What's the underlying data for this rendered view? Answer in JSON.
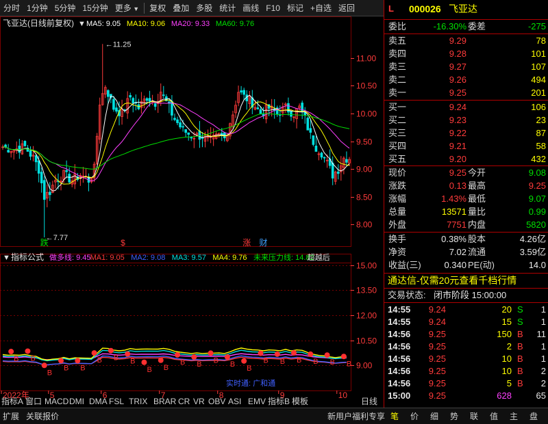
{
  "toolbar": {
    "items": [
      "分时",
      "1分钟",
      "5分钟",
      "15分钟",
      "更多",
      "复权",
      "叠加",
      "多股",
      "统计",
      "画线",
      "F10",
      "标记",
      "+自选",
      "返回"
    ]
  },
  "main_chart": {
    "stock_label": "飞亚达(日线前复权)",
    "ma_legend": [
      {
        "text": "MA5: 9.05",
        "color": "#ffffff"
      },
      {
        "text": "MA10: 9.06",
        "color": "#ffff00"
      },
      {
        "text": "MA20: 9.33",
        "color": "#ff40ff"
      },
      {
        "text": "MA60: 9.76",
        "color": "#00e000"
      }
    ],
    "high_label": "11.25",
    "low_label": "7.77",
    "event_labels": [
      {
        "text": "跌",
        "color": "#00e000"
      },
      {
        "text": "$",
        "color": "#ff3b3b"
      },
      {
        "text": "涨",
        "color": "#ff3b3b"
      },
      {
        "text": "财",
        "color": "#40a0ff"
      }
    ]
  },
  "indicator": {
    "title": "指标公式",
    "legend": [
      {
        "text": "做多线: 9.45",
        "color": "#ff40ff"
      },
      {
        "text": "MA1: 9.05",
        "color": "#ff3b3b"
      },
      {
        "text": "MA2: 9.08",
        "color": "#4060ff"
      },
      {
        "text": "MA3: 9.57",
        "color": "#00e0e0"
      },
      {
        "text": "MA4: 9.76",
        "color": "#ffff00"
      },
      {
        "text": "未来压力线: 14.82",
        "color": "#00e000"
      },
      {
        "text": "超越后",
        "color": "#e0e0e0"
      }
    ],
    "watermark": "实时通: 广和通"
  },
  "chart_data": [
    {
      "type": "candlestick",
      "title": "飞亚达(日线前复权)",
      "y_ticks": [
        8.0,
        8.5,
        9.0,
        9.5,
        10.0,
        10.5,
        11.0
      ],
      "ylim": [
        7.6,
        11.5
      ],
      "x_ticks": [
        {
          "label": "2022年",
          "index": 0
        },
        {
          "label": "5",
          "index": 17
        },
        {
          "label": "6",
          "index": 36
        },
        {
          "label": "7",
          "index": 57
        },
        {
          "label": "8",
          "index": 78
        },
        {
          "label": "9",
          "index": 100
        },
        {
          "label": "10",
          "index": 121
        }
      ],
      "annotations": [
        {
          "text": "11.25",
          "index": 36,
          "value": 11.25
        },
        {
          "text": "7.77",
          "index": 15,
          "value": 7.77
        }
      ],
      "series": [
        {
          "name": "MA5",
          "color": "#ffffff",
          "last": 9.05
        },
        {
          "name": "MA10",
          "color": "#ffff00",
          "last": 9.06
        },
        {
          "name": "MA20",
          "color": "#ff40ff",
          "last": 9.33
        },
        {
          "name": "MA60",
          "color": "#00e000",
          "last": 9.76
        }
      ],
      "close_path": [
        [
          0,
          9.4
        ],
        [
          4,
          9.35
        ],
        [
          8,
          9.4
        ],
        [
          11,
          9.2
        ],
        [
          13,
          9.0
        ],
        [
          15,
          8.5
        ],
        [
          17,
          8.6
        ],
        [
          19,
          8.8
        ],
        [
          22,
          8.9
        ],
        [
          25,
          8.8
        ],
        [
          28,
          8.9
        ],
        [
          31,
          8.8
        ],
        [
          33,
          9.0
        ],
        [
          35,
          10.2
        ],
        [
          37,
          10.5
        ],
        [
          40,
          10.1
        ],
        [
          43,
          10.0
        ],
        [
          46,
          10.3
        ],
        [
          49,
          10.1
        ],
        [
          52,
          10.3
        ],
        [
          55,
          10.2
        ],
        [
          57,
          10.4
        ],
        [
          59,
          10.2
        ],
        [
          62,
          9.9
        ],
        [
          65,
          9.7
        ],
        [
          68,
          9.6
        ],
        [
          72,
          9.6
        ],
        [
          75,
          9.5
        ],
        [
          78,
          9.6
        ],
        [
          80,
          9.55
        ],
        [
          83,
          10.0
        ],
        [
          85,
          10.4
        ],
        [
          87,
          10.3
        ],
        [
          90,
          10.2
        ],
        [
          93,
          10.0
        ],
        [
          96,
          10.1
        ],
        [
          99,
          10.0
        ],
        [
          102,
          10.1
        ],
        [
          105,
          10.0
        ],
        [
          107,
          10.1
        ],
        [
          109,
          9.9
        ],
        [
          111,
          9.6
        ],
        [
          113,
          9.4
        ],
        [
          115,
          9.3
        ],
        [
          117,
          9.1
        ],
        [
          119,
          8.9
        ],
        [
          121,
          9.0
        ],
        [
          123,
          9.2
        ]
      ]
    },
    {
      "type": "line",
      "title": "指标公式",
      "y_ticks": [
        9.0,
        10.5,
        12.0,
        13.5,
        15.0
      ],
      "ylim": [
        8.4,
        15.4
      ],
      "series": [
        {
          "name": "做多线",
          "color": "#ff40ff",
          "last": 9.45
        },
        {
          "name": "MA1",
          "color": "#ff3b3b",
          "last": 9.05
        },
        {
          "name": "MA2",
          "color": "#4060ff",
          "last": 9.08
        },
        {
          "name": "MA3",
          "color": "#00e0e0",
          "last": 9.57
        },
        {
          "name": "MA4",
          "color": "#ffff00",
          "last": 9.76
        },
        {
          "name": "未来压力线",
          "color": "#00e000",
          "last": 14.82
        }
      ]
    }
  ],
  "quote": {
    "level": "L",
    "code": "000026",
    "name": "飞亚达",
    "webi_label": "委比",
    "webi": "-16.30%",
    "weicha_label": "委差",
    "weicha": "-275",
    "asks": [
      {
        "label": "卖五",
        "price": "9.29",
        "vol": "78"
      },
      {
        "label": "卖四",
        "price": "9.28",
        "vol": "101"
      },
      {
        "label": "卖三",
        "price": "9.27",
        "vol": "107"
      },
      {
        "label": "卖二",
        "price": "9.26",
        "vol": "494"
      },
      {
        "label": "卖一",
        "price": "9.25",
        "vol": "201"
      }
    ],
    "bids": [
      {
        "label": "买一",
        "price": "9.24",
        "vol": "106"
      },
      {
        "label": "买二",
        "price": "9.23",
        "vol": "23"
      },
      {
        "label": "买三",
        "price": "9.22",
        "vol": "87"
      },
      {
        "label": "买四",
        "price": "9.21",
        "vol": "58"
      },
      {
        "label": "买五",
        "price": "9.20",
        "vol": "432"
      }
    ],
    "stats": [
      {
        "l1": "现价",
        "v1": "9.25",
        "c1": "red",
        "l2": "今开",
        "v2": "9.08",
        "c2": "green"
      },
      {
        "l1": "涨跌",
        "v1": "0.13",
        "c1": "red",
        "l2": "最高",
        "v2": "9.25",
        "c2": "red"
      },
      {
        "l1": "涨幅",
        "v1": "1.43%",
        "c1": "red",
        "l2": "最低",
        "v2": "9.07",
        "c2": "green"
      },
      {
        "l1": "总量",
        "v1": "13571",
        "c1": "yellow",
        "l2": "量比",
        "v2": "0.99",
        "c2": "green"
      },
      {
        "l1": "外盘",
        "v1": "7751",
        "c1": "red",
        "l2": "内盘",
        "v2": "5820",
        "c2": "green"
      }
    ],
    "stats2": [
      {
        "l1": "换手",
        "v1": "0.38%",
        "l2": "股本",
        "v2": "4.26亿"
      },
      {
        "l1": "净资",
        "v1": "7.02",
        "l2": "流通",
        "v2": "3.59亿"
      },
      {
        "l1": "收益(三)",
        "v1": "0.340",
        "l2": "PE(动)",
        "v2": "14.0"
      }
    ],
    "ad": "通达信-仅需20元查看千档行情",
    "trade_state_label": "交易状态:",
    "trade_state": "闭市阶段 15:00:00",
    "ticks": [
      {
        "time": "14:55",
        "price": "9.24",
        "vol": "20",
        "bs": "S",
        "n": "1",
        "vc": "yellow",
        "bc": "green"
      },
      {
        "time": "14:55",
        "price": "9.24",
        "vol": "15",
        "bs": "S",
        "n": "1",
        "vc": "yellow",
        "bc": "green"
      },
      {
        "time": "14:56",
        "price": "9.25",
        "vol": "150",
        "bs": "B",
        "n": "11",
        "vc": "yellow",
        "bc": "red"
      },
      {
        "time": "14:56",
        "price": "9.25",
        "vol": "2",
        "bs": "B",
        "n": "1",
        "vc": "yellow",
        "bc": "red"
      },
      {
        "time": "14:56",
        "price": "9.25",
        "vol": "10",
        "bs": "B",
        "n": "1",
        "vc": "yellow",
        "bc": "red"
      },
      {
        "time": "14:56",
        "price": "9.25",
        "vol": "10",
        "bs": "B",
        "n": "2",
        "vc": "yellow",
        "bc": "red"
      },
      {
        "time": "14:56",
        "price": "9.25",
        "vol": "5",
        "bs": "B",
        "n": "2",
        "vc": "yellow",
        "bc": "red"
      },
      {
        "time": "15:00",
        "price": "9.25",
        "vol": "628",
        "bs": "",
        "n": "65",
        "vc": "magenta",
        "bc": "red"
      }
    ]
  },
  "bottom": {
    "row1": [
      "指标A",
      "窗口",
      "MACD",
      "DMI",
      "DMA",
      "FSL",
      "TRIX",
      "BRAR",
      "CR",
      "VR",
      "OBV",
      "ASI",
      "EMV",
      "指标B",
      "模板"
    ],
    "period": "日线",
    "row2_left": [
      "扩展",
      "关联报价"
    ],
    "promo": "新用户福利专享",
    "tabs": [
      "笔",
      "价",
      "细",
      "势",
      "联",
      "值",
      "主",
      "盘"
    ]
  },
  "colors": {
    "up": "#ff3b3b",
    "down": "#00e0e0",
    "grid": "#7a0000",
    "axis_text": "#ff3b3b"
  }
}
